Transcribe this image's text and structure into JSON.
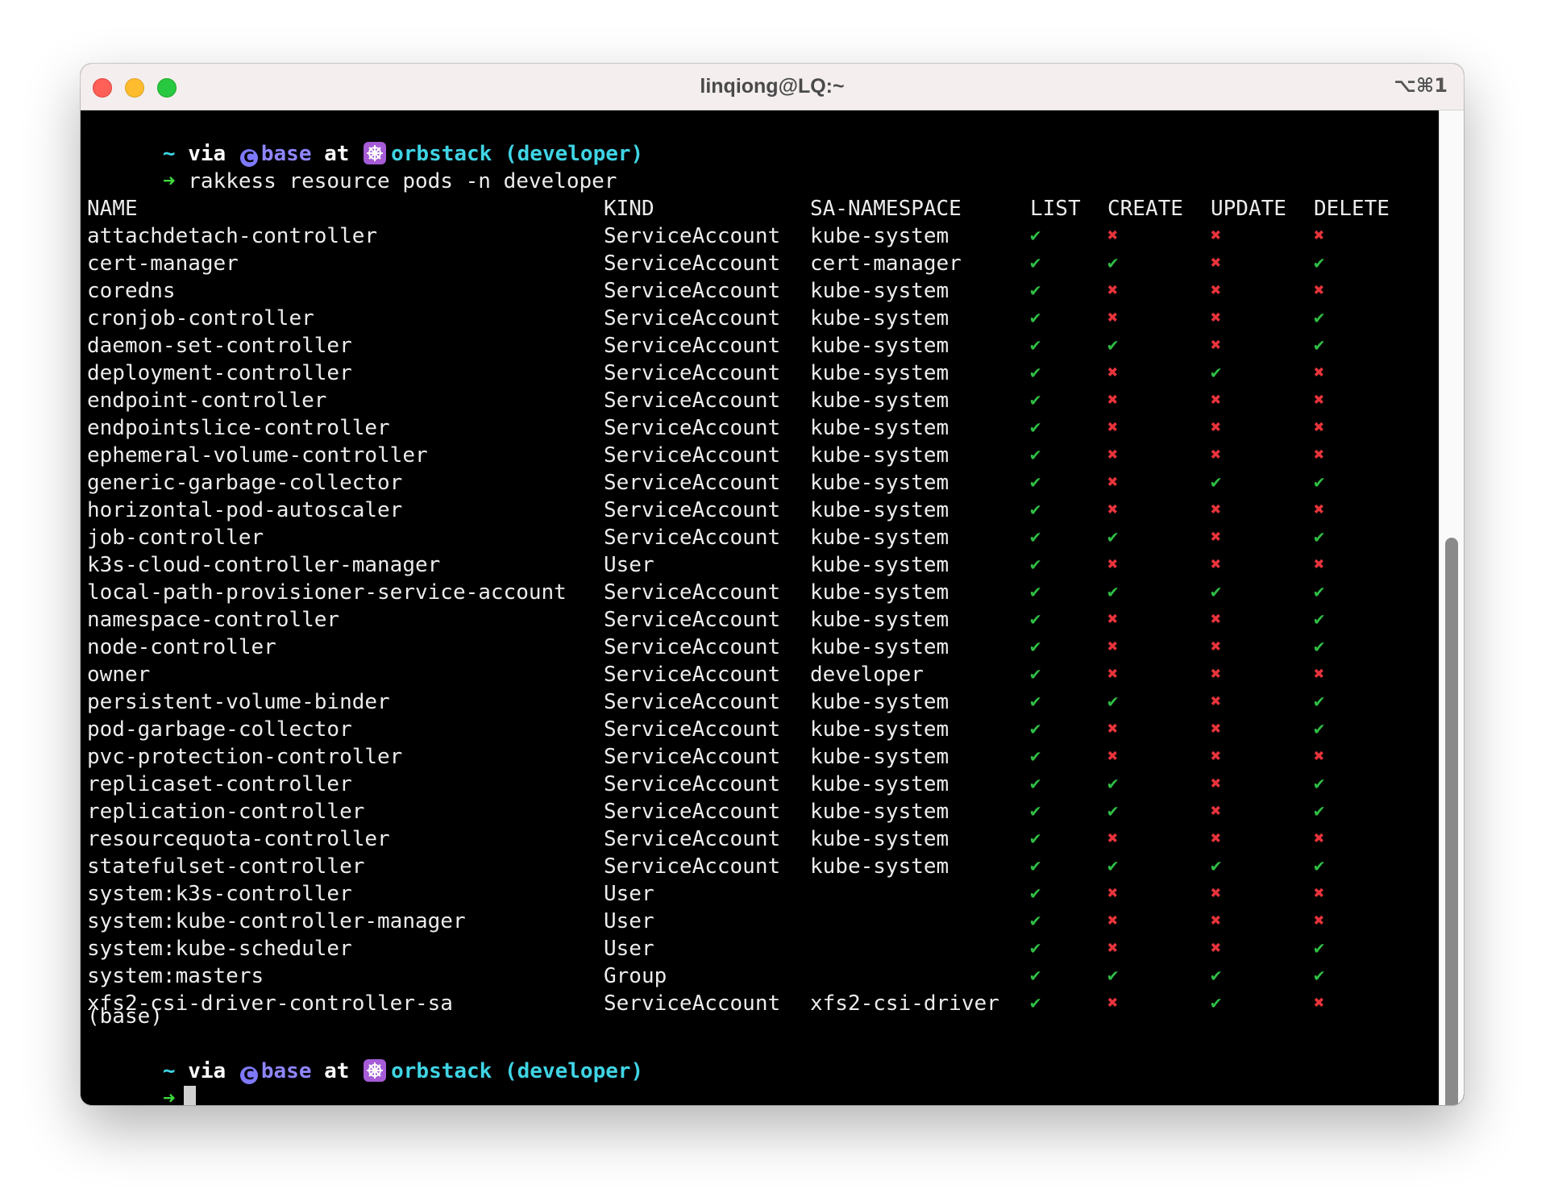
{
  "window": {
    "title": "linqiong@LQ:~",
    "shortcut": "⌥⌘1"
  },
  "prompt": {
    "tilde": "~",
    "via": "via",
    "conda_icon": "conda-c-icon",
    "env": "base",
    "at": "at",
    "k8s_icon": "kubernetes-helm-icon",
    "context": "orbstack (developer)",
    "arrow": "➜"
  },
  "command": "rakkess resource pods -n developer",
  "table": {
    "headers": {
      "name": "NAME",
      "kind": "KIND",
      "ns": "SA-NAMESPACE",
      "list": "LIST",
      "create": "CREATE",
      "update": "UPDATE",
      "delete": "DELETE"
    },
    "yes_mark": "✔",
    "no_mark": "✖",
    "colors": {
      "yes": "#2fbf45",
      "no": "#e8333b"
    },
    "rows": [
      {
        "name": "attachdetach-controller",
        "kind": "ServiceAccount",
        "ns": "kube-system",
        "list": "✔",
        "create": "✖",
        "update": "✖",
        "delete": "✖"
      },
      {
        "name": "cert-manager",
        "kind": "ServiceAccount",
        "ns": "cert-manager",
        "list": "✔",
        "create": "✔",
        "update": "✖",
        "delete": "✔"
      },
      {
        "name": "coredns",
        "kind": "ServiceAccount",
        "ns": "kube-system",
        "list": "✔",
        "create": "✖",
        "update": "✖",
        "delete": "✖"
      },
      {
        "name": "cronjob-controller",
        "kind": "ServiceAccount",
        "ns": "kube-system",
        "list": "✔",
        "create": "✖",
        "update": "✖",
        "delete": "✔"
      },
      {
        "name": "daemon-set-controller",
        "kind": "ServiceAccount",
        "ns": "kube-system",
        "list": "✔",
        "create": "✔",
        "update": "✖",
        "delete": "✔"
      },
      {
        "name": "deployment-controller",
        "kind": "ServiceAccount",
        "ns": "kube-system",
        "list": "✔",
        "create": "✖",
        "update": "✔",
        "delete": "✖"
      },
      {
        "name": "endpoint-controller",
        "kind": "ServiceAccount",
        "ns": "kube-system",
        "list": "✔",
        "create": "✖",
        "update": "✖",
        "delete": "✖"
      },
      {
        "name": "endpointslice-controller",
        "kind": "ServiceAccount",
        "ns": "kube-system",
        "list": "✔",
        "create": "✖",
        "update": "✖",
        "delete": "✖"
      },
      {
        "name": "ephemeral-volume-controller",
        "kind": "ServiceAccount",
        "ns": "kube-system",
        "list": "✔",
        "create": "✖",
        "update": "✖",
        "delete": "✖"
      },
      {
        "name": "generic-garbage-collector",
        "kind": "ServiceAccount",
        "ns": "kube-system",
        "list": "✔",
        "create": "✖",
        "update": "✔",
        "delete": "✔"
      },
      {
        "name": "horizontal-pod-autoscaler",
        "kind": "ServiceAccount",
        "ns": "kube-system",
        "list": "✔",
        "create": "✖",
        "update": "✖",
        "delete": "✖"
      },
      {
        "name": "job-controller",
        "kind": "ServiceAccount",
        "ns": "kube-system",
        "list": "✔",
        "create": "✔",
        "update": "✖",
        "delete": "✔"
      },
      {
        "name": "k3s-cloud-controller-manager",
        "kind": "User",
        "ns": "kube-system",
        "list": "✔",
        "create": "✖",
        "update": "✖",
        "delete": "✖"
      },
      {
        "name": "local-path-provisioner-service-account",
        "kind": "ServiceAccount",
        "ns": "kube-system",
        "list": "✔",
        "create": "✔",
        "update": "✔",
        "delete": "✔"
      },
      {
        "name": "namespace-controller",
        "kind": "ServiceAccount",
        "ns": "kube-system",
        "list": "✔",
        "create": "✖",
        "update": "✖",
        "delete": "✔"
      },
      {
        "name": "node-controller",
        "kind": "ServiceAccount",
        "ns": "kube-system",
        "list": "✔",
        "create": "✖",
        "update": "✖",
        "delete": "✔"
      },
      {
        "name": "owner",
        "kind": "ServiceAccount",
        "ns": "developer",
        "list": "✔",
        "create": "✖",
        "update": "✖",
        "delete": "✖"
      },
      {
        "name": "persistent-volume-binder",
        "kind": "ServiceAccount",
        "ns": "kube-system",
        "list": "✔",
        "create": "✔",
        "update": "✖",
        "delete": "✔"
      },
      {
        "name": "pod-garbage-collector",
        "kind": "ServiceAccount",
        "ns": "kube-system",
        "list": "✔",
        "create": "✖",
        "update": "✖",
        "delete": "✔"
      },
      {
        "name": "pvc-protection-controller",
        "kind": "ServiceAccount",
        "ns": "kube-system",
        "list": "✔",
        "create": "✖",
        "update": "✖",
        "delete": "✖"
      },
      {
        "name": "replicaset-controller",
        "kind": "ServiceAccount",
        "ns": "kube-system",
        "list": "✔",
        "create": "✔",
        "update": "✖",
        "delete": "✔"
      },
      {
        "name": "replication-controller",
        "kind": "ServiceAccount",
        "ns": "kube-system",
        "list": "✔",
        "create": "✔",
        "update": "✖",
        "delete": "✔"
      },
      {
        "name": "resourcequota-controller",
        "kind": "ServiceAccount",
        "ns": "kube-system",
        "list": "✔",
        "create": "✖",
        "update": "✖",
        "delete": "✖"
      },
      {
        "name": "statefulset-controller",
        "kind": "ServiceAccount",
        "ns": "kube-system",
        "list": "✔",
        "create": "✔",
        "update": "✔",
        "delete": "✔"
      },
      {
        "name": "system:k3s-controller",
        "kind": "User",
        "ns": "",
        "list": "✔",
        "create": "✖",
        "update": "✖",
        "delete": "✖"
      },
      {
        "name": "system:kube-controller-manager",
        "kind": "User",
        "ns": "",
        "list": "✔",
        "create": "✖",
        "update": "✖",
        "delete": "✖"
      },
      {
        "name": "system:kube-scheduler",
        "kind": "User",
        "ns": "",
        "list": "✔",
        "create": "✖",
        "update": "✖",
        "delete": "✔"
      },
      {
        "name": "system:masters",
        "kind": "Group",
        "ns": "",
        "list": "✔",
        "create": "✔",
        "update": "✔",
        "delete": "✔"
      },
      {
        "name": "xfs2-csi-driver-controller-sa",
        "kind": "ServiceAccount",
        "ns": "xfs2-csi-driver",
        "list": "✔",
        "create": "✖",
        "update": "✔",
        "delete": "✖"
      }
    ]
  },
  "env_line": "(base)"
}
